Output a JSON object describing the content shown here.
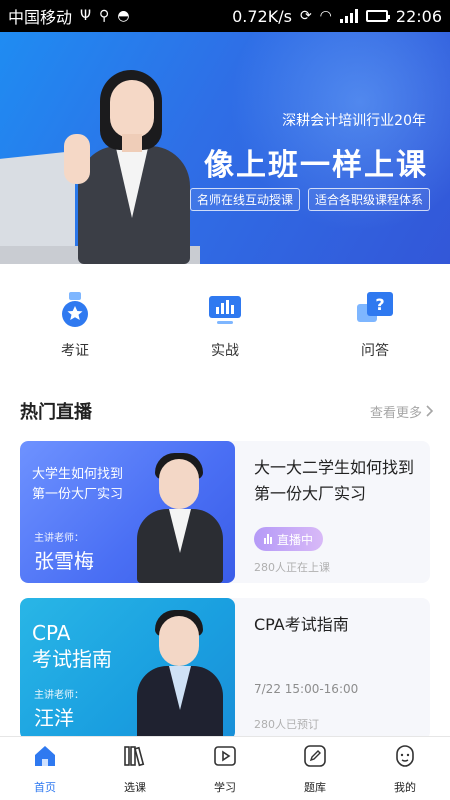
{
  "status_bar": {
    "carrier": "中国移动",
    "speed": "0.72K/s",
    "time": "22:06"
  },
  "banner": {
    "tagline": "深耕会计培训行业20年",
    "headline": "像上班一样上课",
    "pills": [
      "名师在线互动授课",
      "适合各职级课程体系"
    ]
  },
  "quick_nav": [
    {
      "label": "考证",
      "icon": "medal-icon"
    },
    {
      "label": "实战",
      "icon": "chart-monitor-icon"
    },
    {
      "label": "问答",
      "icon": "question-chat-icon"
    }
  ],
  "live_section": {
    "title": "热门直播",
    "more": "查看更多"
  },
  "courses": [
    {
      "thumb_title_line1": "大学生如何找到",
      "thumb_title_line2": "第一份大厂实习",
      "teacher_tag": "主讲老师：",
      "teacher": "张雪梅",
      "title": "大一大二学生如何找到第一份大厂实习",
      "live_label": "直播中",
      "stat": "280人正在上课"
    },
    {
      "thumb_title_line1": "CPA",
      "thumb_title_line2": "考试指南",
      "teacher_tag": "主讲老师：",
      "teacher": "汪洋",
      "title": "CPA考试指南",
      "time": "7/22 15:00-16:00",
      "stat": "280人已预订"
    }
  ],
  "tabbar": [
    {
      "label": "首页",
      "icon": "home-icon",
      "active": true
    },
    {
      "label": "选课",
      "icon": "books-icon",
      "active": false
    },
    {
      "label": "学习",
      "icon": "play-icon",
      "active": false
    },
    {
      "label": "题库",
      "icon": "edit-icon",
      "active": false
    },
    {
      "label": "我的",
      "icon": "profile-icon",
      "active": false
    }
  ],
  "colors": {
    "accent": "#2f79f0",
    "banner_start": "#1f8cf2",
    "banner_end": "#3357d8",
    "live_badge": "#c3a6f7"
  }
}
